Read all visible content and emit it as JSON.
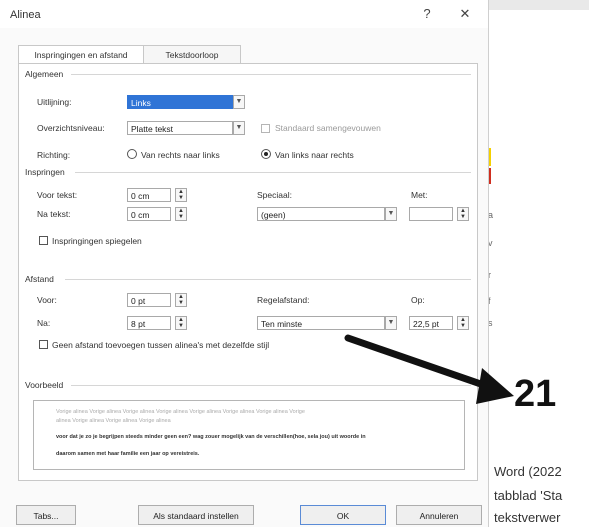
{
  "dialog": {
    "title": "Alinea",
    "help_label": "?",
    "close_label": "✕",
    "tabs": [
      {
        "label": "Inspringingen en afstand",
        "active": true
      },
      {
        "label": "Tekstdoorloop",
        "active": false
      }
    ],
    "general": {
      "section": "Algemeen",
      "alignment_label": "Uitlijning:",
      "alignment_value": "Links",
      "outline_label": "Overzichtsniveau:",
      "outline_value": "Platte tekst",
      "collapsed_label": "Standaard samengevouwen",
      "direction_label": "Richting:",
      "rtl_label": "Van rechts naar links",
      "ltr_label": "Van links naar rechts"
    },
    "indent": {
      "section": "Inspringen",
      "before_label": "Voor tekst:",
      "before_value": "0 cm",
      "after_label": "Na tekst:",
      "after_value": "0 cm",
      "special_label": "Speciaal:",
      "special_value": "(geen)",
      "by_label": "Met:",
      "by_value": "",
      "mirror_label": "Inspringingen spiegelen"
    },
    "spacing": {
      "section": "Afstand",
      "before_label": "Voor:",
      "before_value": "0 pt",
      "after_label": "Na:",
      "after_value": "8 pt",
      "line_label": "Regelafstand:",
      "line_value": "Ten minste",
      "at_label": "Op:",
      "at_value": "22,5 pt",
      "no_space_label": "Geen afstand toevoegen tussen alinea's met dezelfde stijl"
    },
    "preview": {
      "section": "Voorbeeld",
      "line1": "Vorige alinea Vorige alinea Vorige alinea Vorige alinea Vorige alinea Vorige alinea Vorige alinea Vorige",
      "line2": "alinea Vorige alinea Vorige alinea Vorige alinea",
      "line3": "voor dat je zo je begrijpen steeds minder geen een? wag zouer mogelijk van de verschillen(hoe, sela jou) uit woorde in",
      "line4": "daarom samen met haar familie een jaar op vereistreis."
    },
    "buttons": {
      "tabs": "Tabs...",
      "default": "Als standaard instellen",
      "ok": "OK",
      "cancel": "Annuleren"
    }
  },
  "background": {
    "annotation_number": "21",
    "text_lines": [
      "Word (2022",
      "tabblad 'Sta",
      "tekstverwer"
    ],
    "arrow_color": "#111111"
  }
}
